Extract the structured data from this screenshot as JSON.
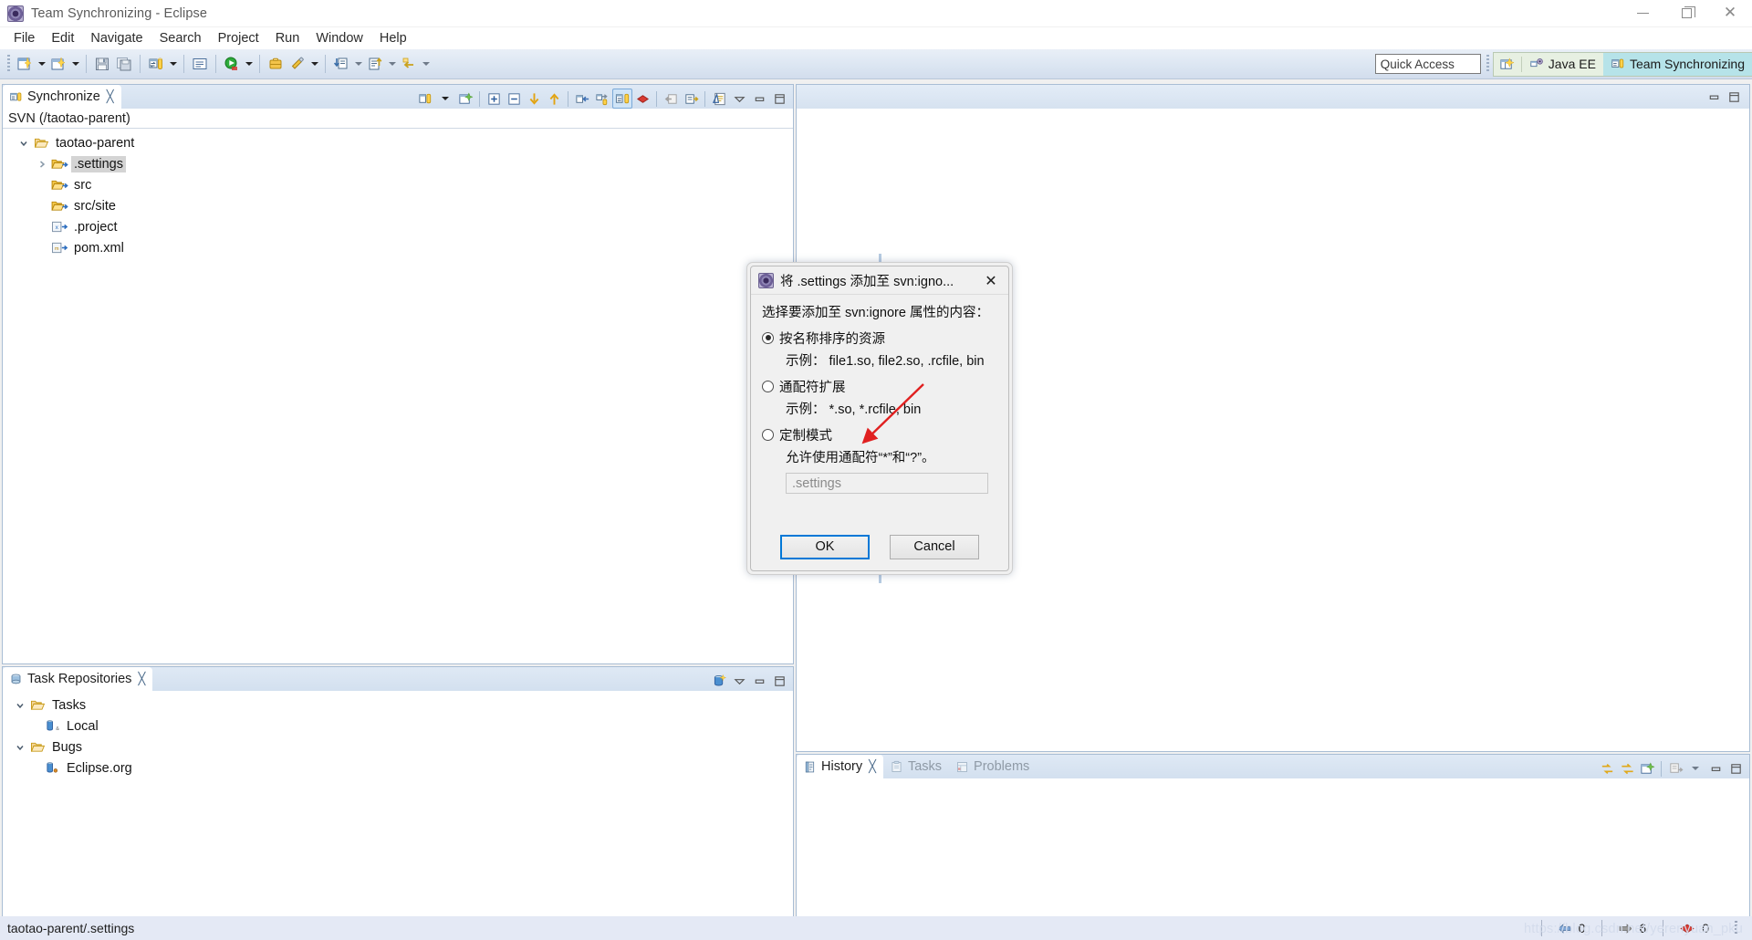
{
  "window": {
    "title": "Team Synchronizing - Eclipse",
    "icon": "eclipse-icon",
    "minimize": "—",
    "restore": "restore",
    "close": "✕"
  },
  "menubar": {
    "items": [
      {
        "label": "File"
      },
      {
        "label": "Edit"
      },
      {
        "label": "Navigate"
      },
      {
        "label": "Search"
      },
      {
        "label": "Project"
      },
      {
        "label": "Run"
      },
      {
        "label": "Window"
      },
      {
        "label": "Help"
      }
    ]
  },
  "toolbar": {
    "quick_access": "Quick Access",
    "perspectives": [
      {
        "label": "Java EE",
        "icon": "java-ee-perspective-icon",
        "active": false
      },
      {
        "label": "Team Synchronizing",
        "icon": "team-sync-perspective-icon",
        "active": true
      }
    ]
  },
  "sync_view": {
    "tab_label": "Synchronize",
    "close_glyph": "╳",
    "description": "SVN (/taotao-parent)",
    "tree": [
      {
        "label": "taotao-parent",
        "depth": 0,
        "twist": "down",
        "icon": "folder-open-icon",
        "selected": false
      },
      {
        "label": ".settings",
        "depth": 1,
        "twist": "right",
        "icon": "folder-outgoing-icon",
        "selected": true
      },
      {
        "label": "src",
        "depth": 1,
        "twist": "none",
        "icon": "folder-outgoing-icon",
        "selected": false
      },
      {
        "label": "src/site",
        "depth": 1,
        "twist": "none",
        "icon": "folder-outgoing-icon",
        "selected": false
      },
      {
        "label": ".project",
        "depth": 1,
        "twist": "none",
        "icon": "xml-file-outgoing-icon",
        "selected": false
      },
      {
        "label": "pom.xml",
        "depth": 1,
        "twist": "none",
        "icon": "maven-file-outgoing-icon",
        "selected": false
      }
    ]
  },
  "task_repositories_view": {
    "tab_label": "Task Repositories",
    "close_glyph": "╳",
    "tree": [
      {
        "label": "Tasks",
        "depth": 0,
        "twist": "down",
        "icon": "folder-open-icon"
      },
      {
        "label": "Local",
        "depth": 1,
        "twist": "none",
        "icon": "repository-local-icon"
      },
      {
        "label": "Bugs",
        "depth": 0,
        "twist": "down",
        "icon": "folder-open-icon"
      },
      {
        "label": "Eclipse.org",
        "depth": 1,
        "twist": "none",
        "icon": "repository-bugzilla-icon"
      }
    ]
  },
  "history_view": {
    "tabs": [
      {
        "label": "History",
        "icon": "history-icon",
        "active": true,
        "close_glyph": "╳"
      },
      {
        "label": "Tasks",
        "icon": "tasks-icon",
        "active": false
      },
      {
        "label": "Problems",
        "icon": "problems-icon",
        "active": false
      }
    ]
  },
  "dialog": {
    "icon": "eclipse-icon",
    "title": "将 .settings 添加至 svn:igno...",
    "close_glyph": "✕",
    "prompt": "选择要添加至 svn:ignore 属性的内容：",
    "options": [
      {
        "label": "按名称排序的资源",
        "hint": "示例： file1.so, file2.so, .rcfile, bin",
        "selected": true
      },
      {
        "label": "通配符扩展",
        "hint": "示例： *.so, *.rcfile, bin",
        "selected": false
      },
      {
        "label": "定制模式",
        "hint": "允许使用通配符“*”和“?”。",
        "selected": false
      }
    ],
    "pattern_input_value": ".settings",
    "ok_label": "OK",
    "cancel_label": "Cancel"
  },
  "statusbar": {
    "path": "taotao-parent/.settings",
    "counters": [
      {
        "icon": "incoming-arrow-icon",
        "value": "0",
        "color": "#7fa6d6"
      },
      {
        "icon": "outgoing-arrow-icon",
        "value": "6",
        "color": "#8a8a8a"
      },
      {
        "icon": "conflict-icon",
        "value": "0",
        "color": "#d03a35"
      }
    ]
  },
  "watermark": "https://blog.csdn.net/yerenyuan_pku",
  "colors": {
    "accent": "#0078d7",
    "perspective_active": "#b6e3e9",
    "selection": "#d4d4d4",
    "annotation_arrow": "#e02020"
  }
}
